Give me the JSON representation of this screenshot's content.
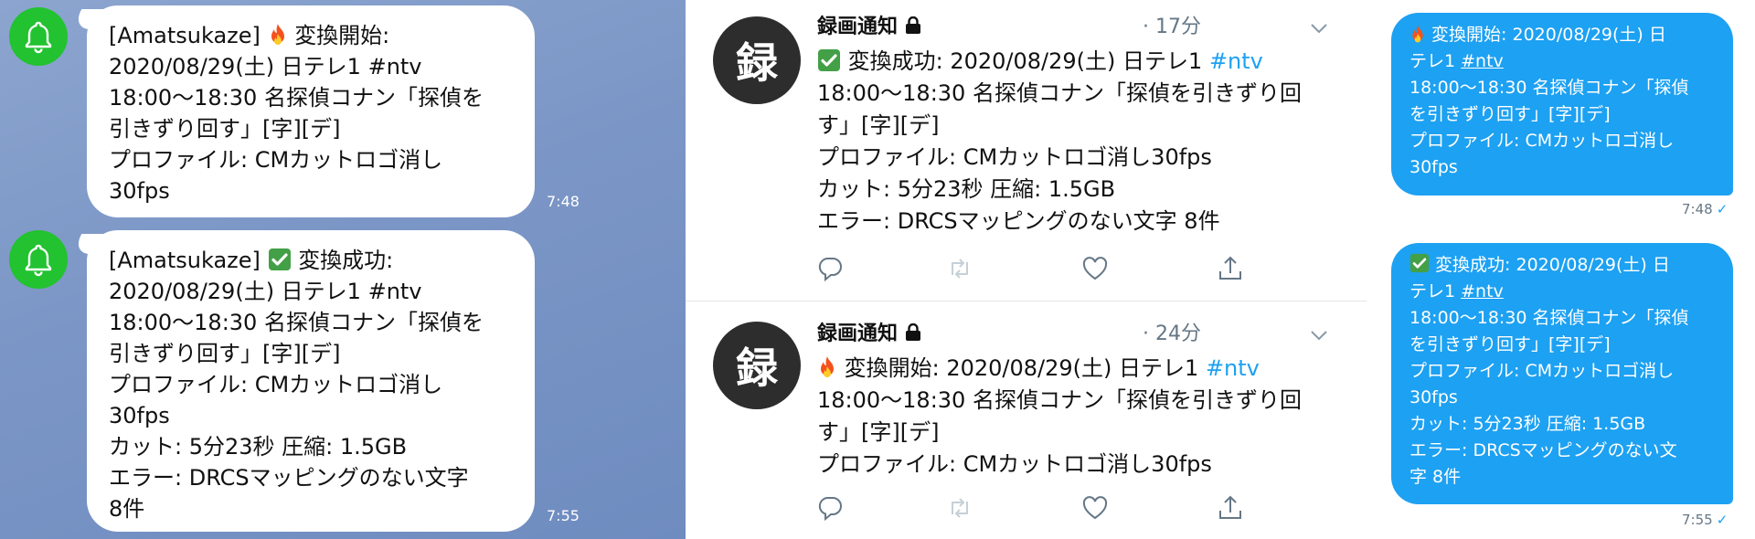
{
  "line": {
    "messages": [
      {
        "sender": "[Amatsukaze]",
        "icon": "fire",
        "head": "変換開始:",
        "lines": "2020/08/29(土) 日テレ1 #ntv\n18:00〜18:30 名探偵コナン「探偵を\n引きずり回す」[字][デ]\nプロファイル: CMカットロゴ消し\n30fps",
        "time": "7:48"
      },
      {
        "sender": "[Amatsukaze]",
        "icon": "check",
        "head": "変換成功:",
        "lines": "2020/08/29(土) 日テレ1 #ntv\n18:00〜18:30 名探偵コナン「探偵を\n引きずり回す」[字][デ]\nプロファイル: CMカットロゴ消し\n30fps\nカット: 5分23秒 圧縮: 1.5GB\nエラー: DRCSマッピングのない文字\n8件",
        "time": "7:55"
      }
    ],
    "avatar_icon": "bell-icon",
    "accent": "#22c230"
  },
  "timeline": {
    "tweets": [
      {
        "avatar_char": "録",
        "name": "録画通知",
        "time": "· 17分",
        "icon": "check",
        "first": "変換成功: 2020/08/29(土) 日テレ1 ",
        "hashtag": "#ntv",
        "rest": "18:00〜18:30 名探偵コナン「探偵を引きずり回\nす」[字][デ]\nプロファイル: CMカットロゴ消し30fps\nカット: 5分23秒 圧縮: 1.5GB\nエラー: DRCSマッピングのない文字 8件"
      },
      {
        "avatar_char": "録",
        "name": "録画通知",
        "time": "· 24分",
        "icon": "fire",
        "first": "変換開始: 2020/08/29(土) 日テレ1 ",
        "hashtag": "#ntv",
        "rest": "18:00〜18:30 名探偵コナン「探偵を引きずり回\nす」[字][デ]\nプロファイル: CMカットロゴ消し30fps"
      }
    ],
    "accent": "#1da1f2"
  },
  "dm": {
    "messages": [
      {
        "icon": "fire",
        "first": "変換開始: 2020/08/29(土) 日",
        "line2_pre": "テレ1 ",
        "hashtag": "#ntv",
        "rest": "18:00〜18:30 名探偵コナン「探偵\nを引きずり回す」[字][デ]\nプロファイル: CMカットロゴ消し\n30fps",
        "time": "7:48",
        "check": "✓"
      },
      {
        "icon": "check",
        "first": "変換成功: 2020/08/29(土) 日",
        "line2_pre": "テレ1 ",
        "hashtag": "#ntv",
        "rest": "18:00〜18:30 名探偵コナン「探偵\nを引きずり回す」[字][デ]\nプロファイル: CMカットロゴ消し\n30fps\nカット: 5分23秒 圧縮: 1.5GB\nエラー: DRCSマッピングのない文\n字 8件",
        "time": "7:55",
        "check": "✓"
      }
    ],
    "bubble_color": "#1da1f2"
  }
}
